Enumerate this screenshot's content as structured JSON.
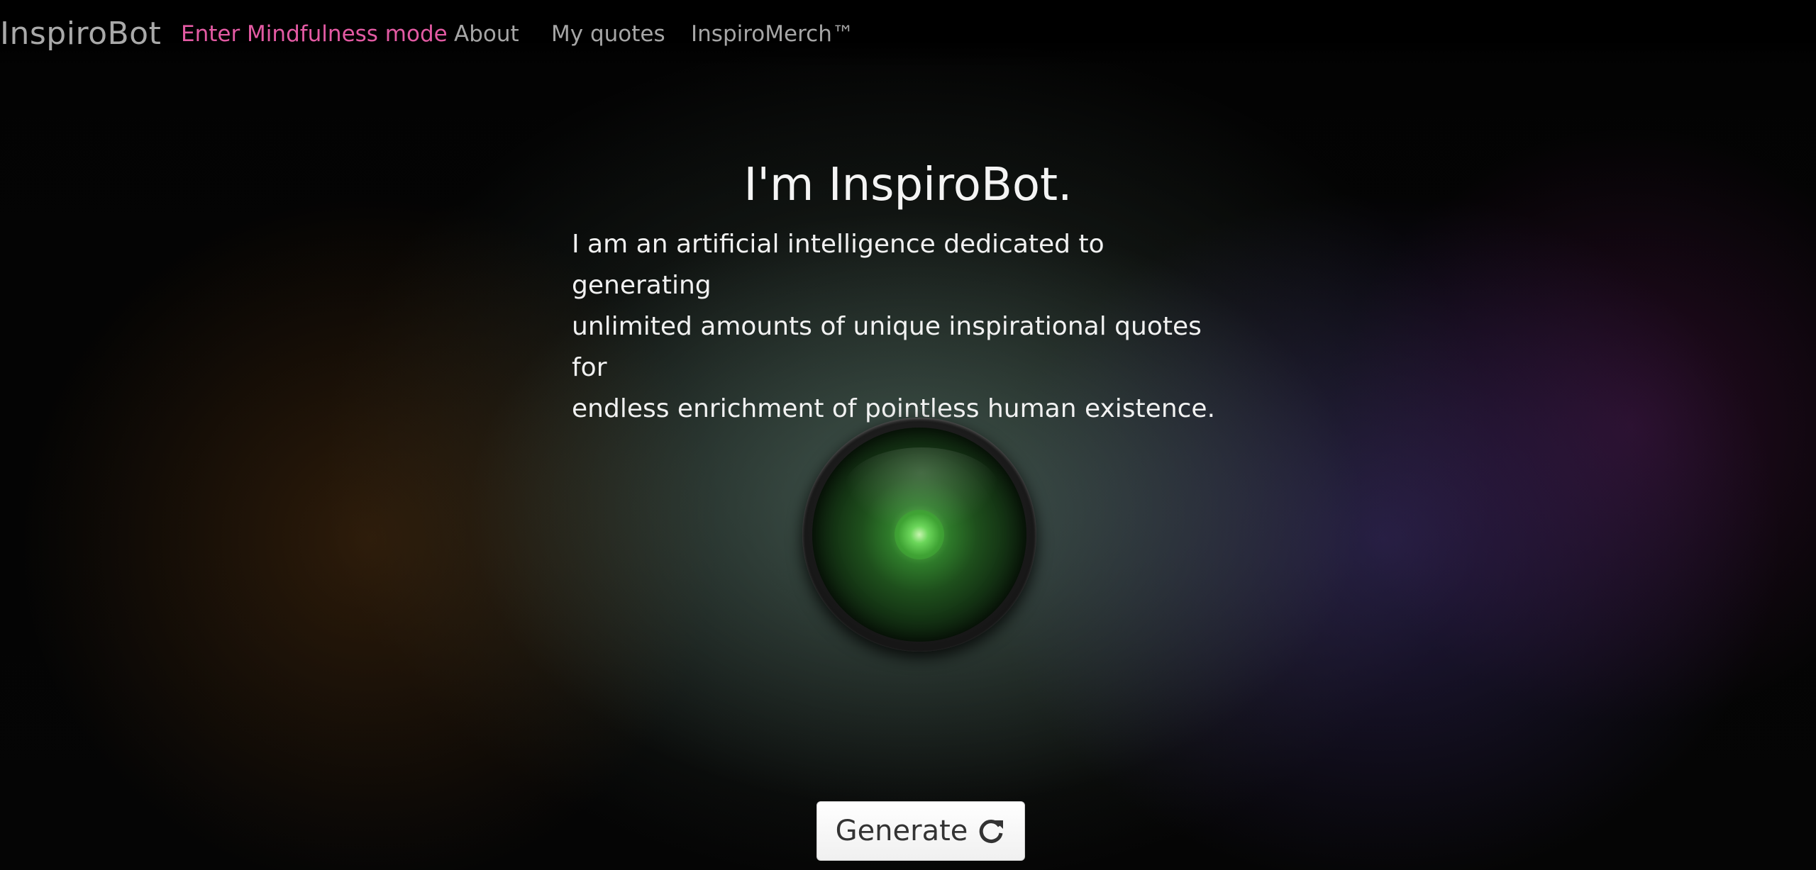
{
  "brand": "InspiroBot",
  "nav": {
    "mindfulness": "Enter Mindfulness mode",
    "about": "About",
    "my_quotes": "My quotes",
    "merch": "InspiroMerch™"
  },
  "hero": {
    "title": "I'm InspiroBot.",
    "lines": [
      "I am an artificial intelligence dedicated to generating",
      "unlimited amounts of unique inspirational quotes for",
      "endless enrichment of pointless human existence."
    ]
  },
  "generate": {
    "label": "Generate",
    "icon": "refresh-icon"
  },
  "colors": {
    "accent_nav": "#e35aa3",
    "nav_text": "#a6a6a6",
    "eye_glow": "#4aa63e"
  }
}
